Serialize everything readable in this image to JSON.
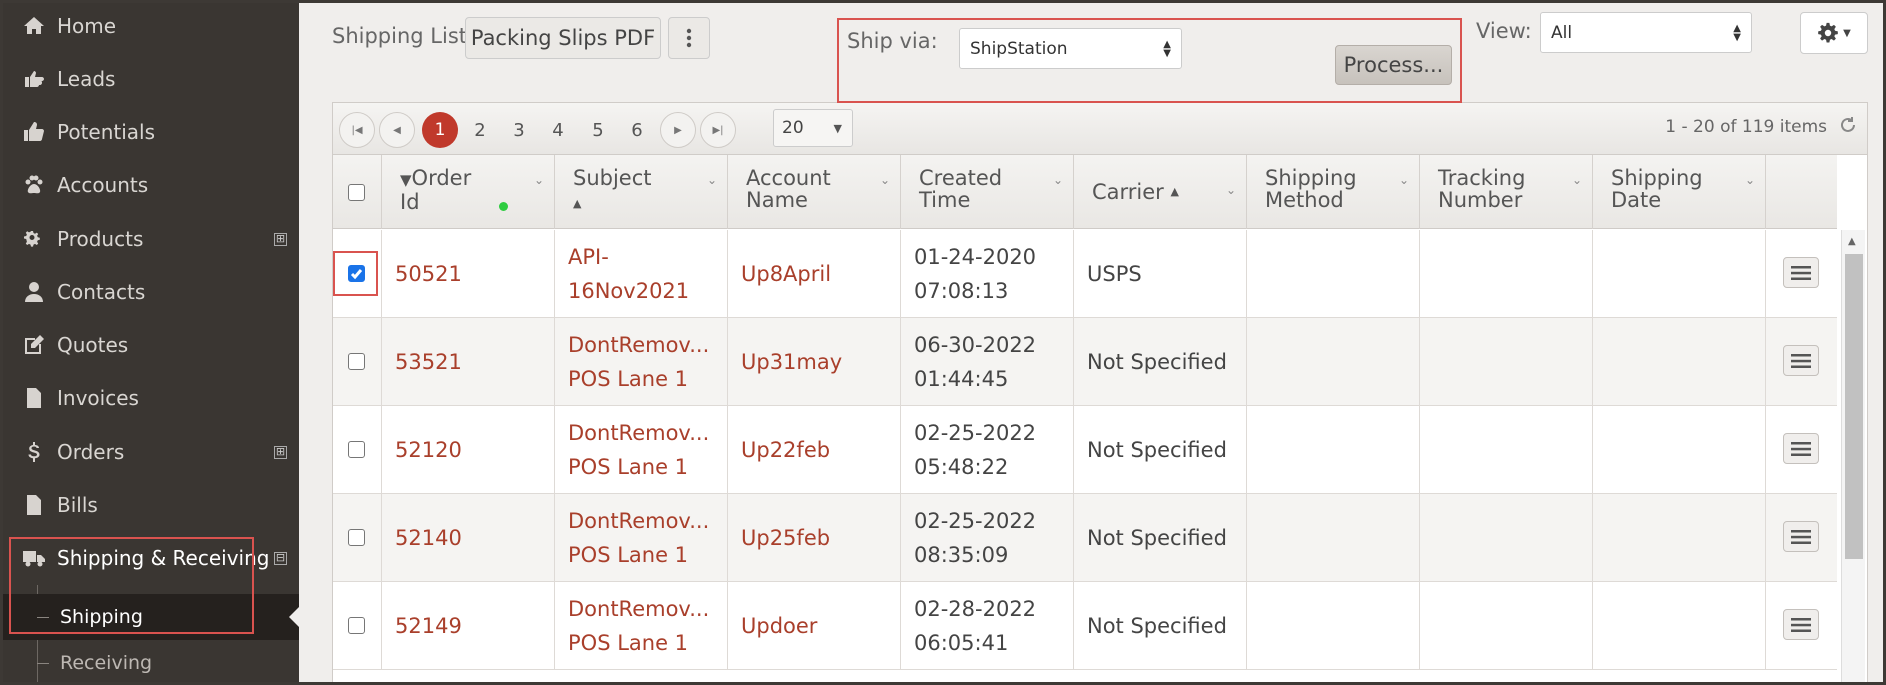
{
  "sidebar": {
    "items": [
      {
        "label": "Home",
        "icon": "home-icon"
      },
      {
        "label": "Leads",
        "icon": "hand-pointing-icon"
      },
      {
        "label": "Potentials",
        "icon": "thumbs-up-icon"
      },
      {
        "label": "Accounts",
        "icon": "paw-icon"
      },
      {
        "label": "Products",
        "icon": "gears-icon",
        "expand": "⊞"
      },
      {
        "label": "Contacts",
        "icon": "user-icon"
      },
      {
        "label": "Quotes",
        "icon": "edit-icon"
      },
      {
        "label": "Invoices",
        "icon": "file-text-icon"
      },
      {
        "label": "Orders",
        "icon": "dollar-icon",
        "expand": "⊞"
      },
      {
        "label": "Bills",
        "icon": "file-icon"
      },
      {
        "label": "Shipping & Receiving",
        "icon": "truck-icon",
        "expand": "⊟"
      }
    ],
    "subitems": [
      {
        "label": "Shipping"
      },
      {
        "label": "Receiving"
      }
    ]
  },
  "toolbar": {
    "shipping_list_label": "Shipping List",
    "packing_slips_label": "Packing Slips PDF",
    "ship_via_label": "Ship via:",
    "ship_via_value": "ShipStation",
    "process_label": "Process...",
    "view_label": "View:",
    "view_value": "All"
  },
  "pager": {
    "pages": [
      "1",
      "2",
      "3",
      "4",
      "5",
      "6"
    ],
    "current_page": "1",
    "page_size": "20",
    "info": "1 - 20 of 119 items"
  },
  "columns": [
    {
      "line1": "Order",
      "line2": "Id"
    },
    {
      "line1": "Subject",
      "line2": ""
    },
    {
      "line1": "Account",
      "line2": "Name"
    },
    {
      "line1": "Created",
      "line2": "Time"
    },
    {
      "line1": "Carrier",
      "line2": ""
    },
    {
      "line1": "Shipping",
      "line2": "Method"
    },
    {
      "line1": "Tracking",
      "line2": "Number"
    },
    {
      "line1": "Shipping",
      "line2": "Date"
    }
  ],
  "rows": [
    {
      "checked": true,
      "order_id": "50521",
      "subject1": "API-",
      "subject2": "16Nov2021",
      "account": "Up8April",
      "created1": "01-24-2020",
      "created2": "07:08:13",
      "carrier": "USPS"
    },
    {
      "checked": false,
      "order_id": "53521",
      "subject1": "DontRemov...",
      "subject2": "POS Lane 1",
      "account": "Up31may",
      "created1": "06-30-2022",
      "created2": "01:44:45",
      "carrier": "Not Specified"
    },
    {
      "checked": false,
      "order_id": "52120",
      "subject1": "DontRemov...",
      "subject2": "POS Lane 1",
      "account": "Up22feb",
      "created1": "02-25-2022",
      "created2": "05:48:22",
      "carrier": "Not Specified"
    },
    {
      "checked": false,
      "order_id": "52140",
      "subject1": "DontRemov...",
      "subject2": "POS Lane 1",
      "account": "Up25feb",
      "created1": "02-25-2022",
      "created2": "08:35:09",
      "carrier": "Not Specified"
    },
    {
      "checked": false,
      "order_id": "52149",
      "subject1": "DontRemov...",
      "subject2": "POS Lane 1",
      "account": "Updoer",
      "created1": "02-28-2022",
      "created2": "06:05:41",
      "carrier": "Not Specified"
    }
  ],
  "colors": {
    "sidebar_bg": "#3a3632",
    "link": "#a93f2b",
    "current_page": "#c0392b",
    "highlight_box": "#d9534f"
  }
}
